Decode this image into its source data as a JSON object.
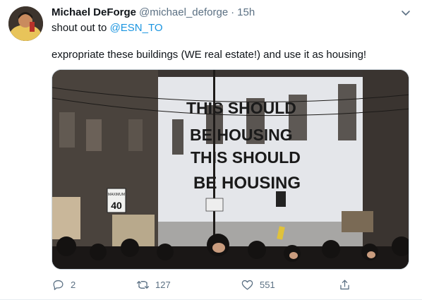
{
  "tweet": {
    "author": {
      "display_name": "Michael DeForge",
      "handle": "@michael_deforge",
      "avatar": "avatar-photo"
    },
    "separator": "·",
    "time": "15h",
    "text_prefix": "shout out to ",
    "mention": "@ESN_TO",
    "body": "expropriate these buildings (WE real estate!) and use it as housing!",
    "more_icon": "chevron-down-icon",
    "photo": {
      "projected_lines": [
        "THIS SHOULD",
        "BE HOUSING",
        "THIS SHOULD",
        "BE HOUSING"
      ],
      "speed_sign_header": "MAXIMUM",
      "speed_sign_value": "40"
    },
    "actions": {
      "reply": {
        "icon": "reply-icon",
        "count": "2"
      },
      "retweet": {
        "icon": "retweet-icon",
        "count": "127"
      },
      "like": {
        "icon": "heart-icon",
        "count": "551"
      },
      "share": {
        "icon": "share-icon"
      }
    }
  },
  "colors": {
    "text": "#0f1419",
    "secondary": "#5b7083",
    "link": "#1b95e0"
  }
}
